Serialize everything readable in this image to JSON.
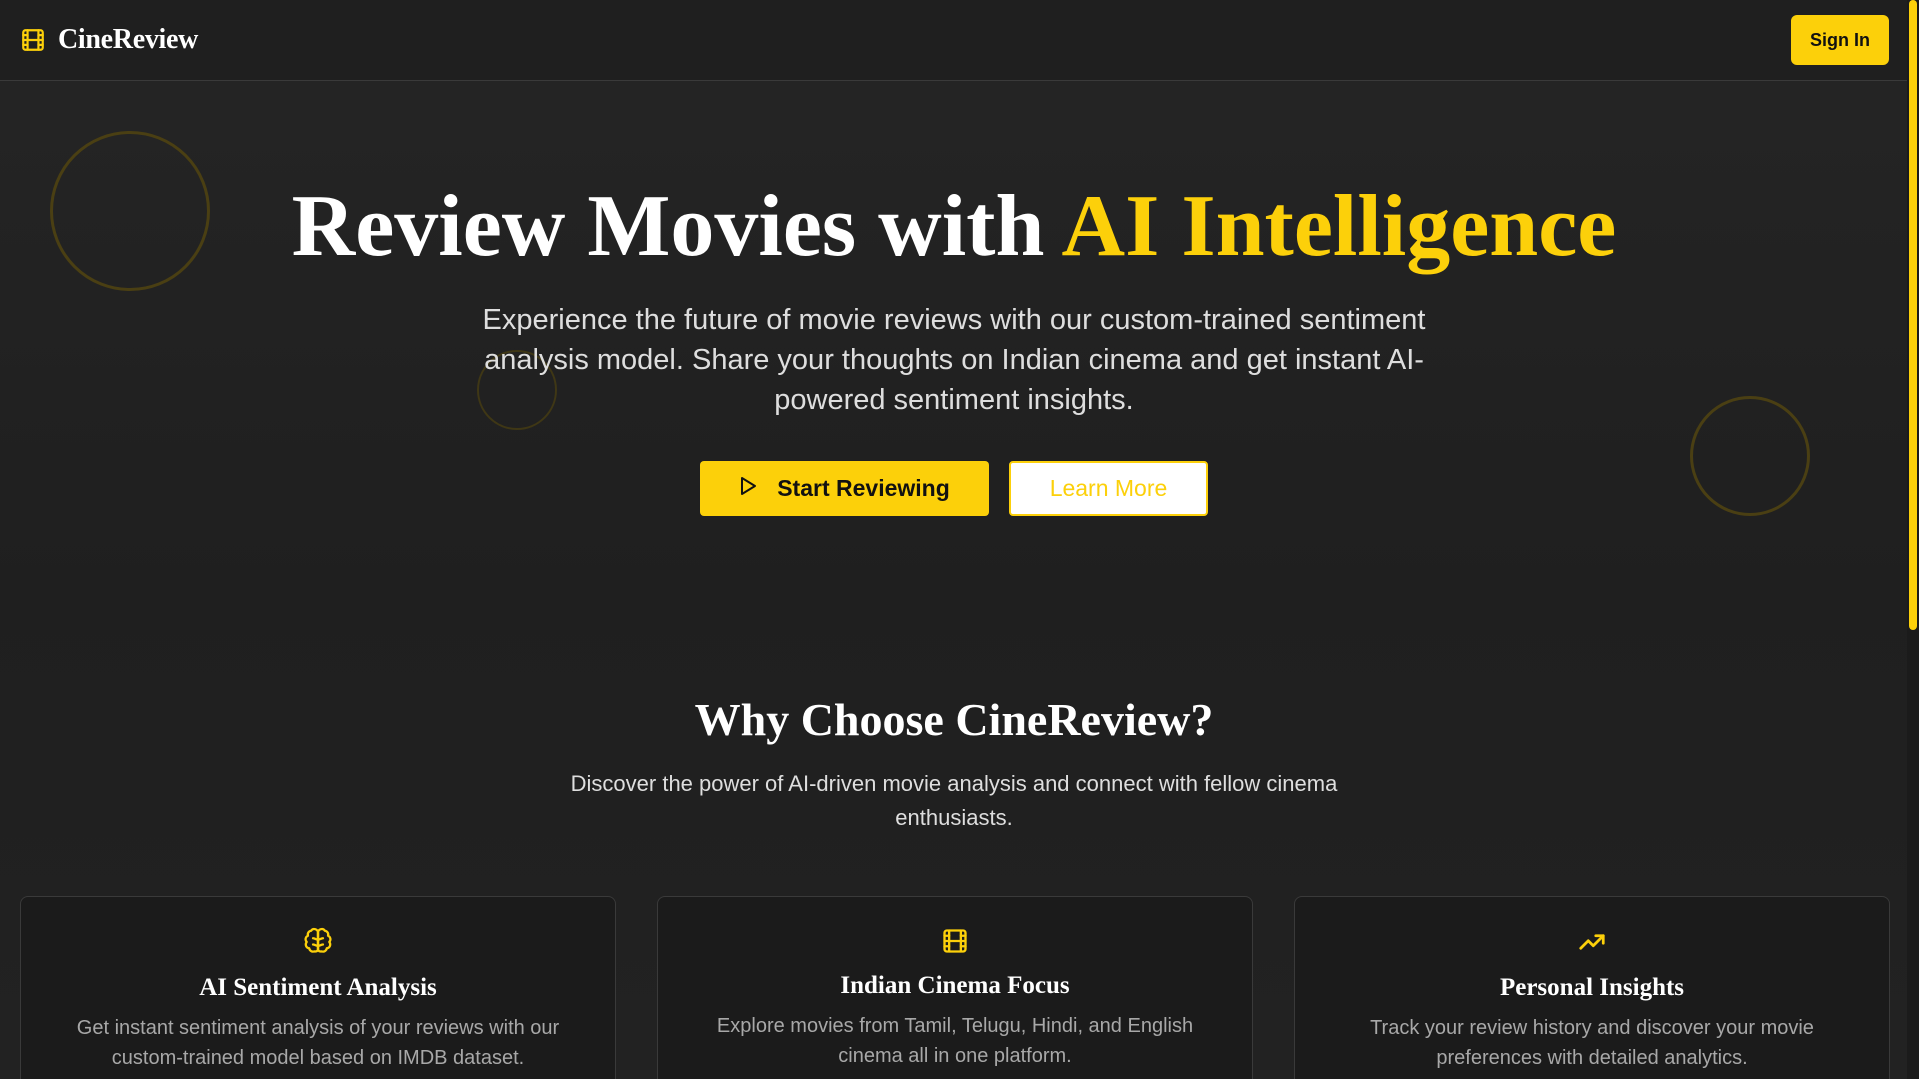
{
  "navbar": {
    "brand": "CineReview",
    "brand_icon": "film-icon",
    "signin_label": "Sign In"
  },
  "hero": {
    "title_main": "Review Movies with ",
    "title_accent": "AI Intelligence",
    "subtitle": "Experience the future of movie reviews with our custom-trained sentiment analysis model. Share your thoughts on Indian cinema and get instant AI-powered sentiment insights.",
    "primary_button": {
      "label": "Start Reviewing",
      "icon": "play-icon"
    },
    "secondary_button": {
      "label": "Learn More"
    }
  },
  "why": {
    "title": "Why Choose CineReview?",
    "subtitle": "Discover the power of AI-driven movie analysis and connect with fellow cinema enthusiasts."
  },
  "features": [
    {
      "icon": "brain-icon",
      "title": "AI Sentiment Analysis",
      "description": "Get instant sentiment analysis of your reviews with our custom-trained model based on IMDB dataset."
    },
    {
      "icon": "film-icon",
      "title": "Indian Cinema Focus",
      "description": "Explore movies from Tamil, Telugu, Hindi, and English cinema all in one platform."
    },
    {
      "icon": "trending-up-icon",
      "title": "Personal Insights",
      "description": "Track your review history and discover your movie preferences with detailed analytics."
    }
  ],
  "colors": {
    "accent": "#fcd00a",
    "background": "#1f1f1f",
    "card_background": "#1b1b1b",
    "text_muted": "#a8a8a8"
  }
}
